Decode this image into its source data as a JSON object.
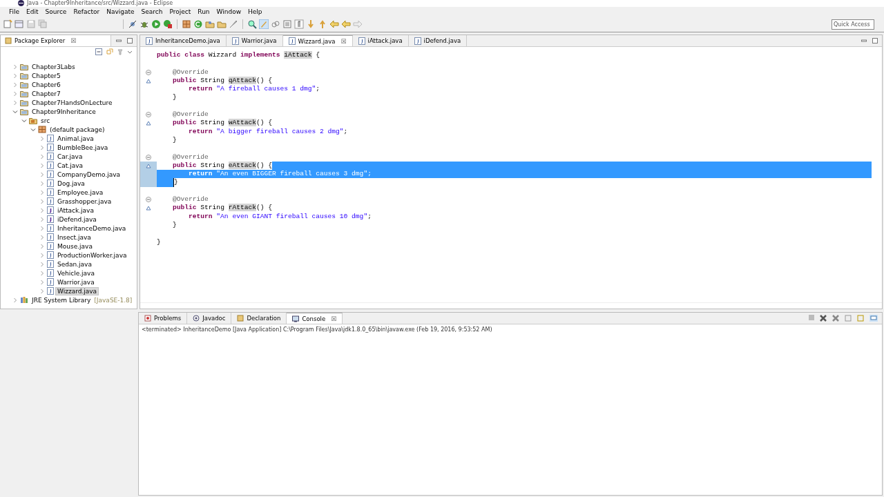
{
  "window": {
    "title": "Java - Chapter9Inheritance/src/Wizzard.java - Eclipse"
  },
  "menu": [
    "File",
    "Edit",
    "Source",
    "Refactor",
    "Navigate",
    "Search",
    "Project",
    "Run",
    "Window",
    "Help"
  ],
  "quick_access": {
    "placeholder": "Quick Access"
  },
  "package_explorer": {
    "title": "Package Explorer",
    "close": "☒",
    "tree": [
      {
        "label": "Chapter3Labs",
        "kind": "project",
        "expanded": false,
        "selected": false
      },
      {
        "label": "Chapter5",
        "kind": "project",
        "expanded": false,
        "selected": false
      },
      {
        "label": "Chapter6",
        "kind": "project",
        "expanded": false,
        "selected": false
      },
      {
        "label": "Chapter7",
        "kind": "project",
        "expanded": false,
        "selected": false
      },
      {
        "label": "Chapter7HandsOnLecture",
        "kind": "project",
        "expanded": false,
        "selected": false
      },
      {
        "label": "Chapter9Inheritance",
        "kind": "project",
        "expanded": true,
        "selected": false,
        "children": [
          {
            "label": "src",
            "kind": "source",
            "expanded": true,
            "selected": false,
            "children": [
              {
                "label": "(default package)",
                "kind": "package",
                "expanded": true,
                "selected": false,
                "children": [
                  {
                    "label": "Animal.java",
                    "kind": "java",
                    "expanded": false,
                    "selected": false
                  },
                  {
                    "label": "BumbleBee.java",
                    "kind": "java",
                    "expanded": false,
                    "selected": false
                  },
                  {
                    "label": "Car.java",
                    "kind": "java",
                    "expanded": false,
                    "selected": false
                  },
                  {
                    "label": "Cat.java",
                    "kind": "java",
                    "expanded": false,
                    "selected": false
                  },
                  {
                    "label": "CompanyDemo.java",
                    "kind": "java",
                    "expanded": false,
                    "selected": false
                  },
                  {
                    "label": "Dog.java",
                    "kind": "java",
                    "expanded": false,
                    "selected": false
                  },
                  {
                    "label": "Employee.java",
                    "kind": "java",
                    "expanded": false,
                    "selected": false
                  },
                  {
                    "label": "Grasshopper.java",
                    "kind": "java",
                    "expanded": false,
                    "selected": false
                  },
                  {
                    "label": "iAttack.java",
                    "kind": "interface",
                    "expanded": false,
                    "selected": false
                  },
                  {
                    "label": "iDefend.java",
                    "kind": "interface",
                    "expanded": false,
                    "selected": false
                  },
                  {
                    "label": "InheritanceDemo.java",
                    "kind": "java",
                    "expanded": false,
                    "selected": false
                  },
                  {
                    "label": "Insect.java",
                    "kind": "java",
                    "expanded": false,
                    "selected": false
                  },
                  {
                    "label": "Mouse.java",
                    "kind": "java",
                    "expanded": false,
                    "selected": false
                  },
                  {
                    "label": "ProductionWorker.java",
                    "kind": "java",
                    "expanded": false,
                    "selected": false
                  },
                  {
                    "label": "Sedan.java",
                    "kind": "java",
                    "expanded": false,
                    "selected": false
                  },
                  {
                    "label": "Vehicle.java",
                    "kind": "java",
                    "expanded": false,
                    "selected": false
                  },
                  {
                    "label": "Warrior.java",
                    "kind": "java",
                    "expanded": false,
                    "selected": false
                  },
                  {
                    "label": "Wizzard.java",
                    "kind": "java",
                    "expanded": false,
                    "selected": true
                  }
                ]
              }
            ]
          }
        ]
      },
      {
        "label": "JRE System Library",
        "decoration": "[JavaSE-1.8]",
        "kind": "library",
        "expanded": false,
        "selected": false
      }
    ]
  },
  "editor_tabs": [
    {
      "label": "InheritanceDemo.java",
      "selected": false
    },
    {
      "label": "Warrior.java",
      "selected": false
    },
    {
      "label": "Wizzard.java",
      "selected": true,
      "close": "☒"
    },
    {
      "label": "iAttack.java",
      "selected": false
    },
    {
      "label": "iDefend.java",
      "selected": false
    }
  ],
  "code": [
    {
      "kind": "class",
      "selected": false,
      "tokens": [
        {
          "t": "public class ",
          "kind": "keyword"
        },
        {
          "t": "Wizzard ",
          "kind": "plain"
        },
        {
          "t": "implements ",
          "kind": "keyword"
        },
        {
          "t": "iAttack",
          "kind": "occurrence"
        },
        {
          "t": " {",
          "kind": "plain"
        }
      ]
    },
    {
      "kind": "blank",
      "selected": false
    },
    {
      "kind": "annotation",
      "selected": false,
      "tokens": [
        {
          "t": "    @Override",
          "kind": "annotation"
        }
      ]
    },
    {
      "kind": "method",
      "selected": false,
      "tokens": [
        {
          "t": "    public ",
          "kind": "keyword"
        },
        {
          "t": "String ",
          "kind": "plain"
        },
        {
          "t": "qAttack",
          "kind": "occurrence"
        },
        {
          "t": "() {",
          "kind": "plain"
        }
      ]
    },
    {
      "kind": "statement",
      "selected": false,
      "tokens": [
        {
          "t": "        return ",
          "kind": "keyword"
        },
        {
          "t": "\"A fireball causes 1 dmg\"",
          "kind": "string"
        },
        {
          "t": ";",
          "kind": "plain"
        }
      ]
    },
    {
      "kind": "statement",
      "selected": false,
      "tokens": [
        {
          "t": "    }",
          "kind": "plain"
        }
      ]
    },
    {
      "kind": "blank",
      "selected": false
    },
    {
      "kind": "annotation",
      "selected": false,
      "tokens": [
        {
          "t": "    @Override",
          "kind": "annotation"
        }
      ]
    },
    {
      "kind": "method",
      "selected": false,
      "tokens": [
        {
          "t": "    public ",
          "kind": "keyword"
        },
        {
          "t": "String ",
          "kind": "plain"
        },
        {
          "t": "wAttack",
          "kind": "occurrence"
        },
        {
          "t": "() {",
          "kind": "plain"
        }
      ]
    },
    {
      "kind": "statement",
      "selected": false,
      "tokens": [
        {
          "t": "        return ",
          "kind": "keyword"
        },
        {
          "t": "\"A bigger fireball causes 2 dmg\"",
          "kind": "string"
        },
        {
          "t": ";",
          "kind": "plain"
        }
      ]
    },
    {
      "kind": "statement",
      "selected": false,
      "tokens": [
        {
          "t": "    }",
          "kind": "plain"
        }
      ]
    },
    {
      "kind": "blank",
      "selected": false
    },
    {
      "kind": "annotation",
      "selected": false,
      "tokens": [
        {
          "t": "    @Override",
          "kind": "annotation"
        }
      ]
    },
    {
      "kind": "method",
      "selected": true,
      "tokens": [
        {
          "t": "    public ",
          "kind": "keyword"
        },
        {
          "t": "String ",
          "kind": "plain"
        },
        {
          "t": "eAttack",
          "kind": "occurrence"
        },
        {
          "t": "() {",
          "kind": "plain"
        }
      ]
    },
    {
      "kind": "statement",
      "selected": true,
      "tokens": [
        {
          "t": "        return ",
          "kind": "keyword"
        },
        {
          "t": "\"An even BIGGER fireball causes 3 dmg\"",
          "kind": "string"
        },
        {
          "t": ";",
          "kind": "plain"
        }
      ]
    },
    {
      "kind": "statement",
      "selected": true,
      "tokens": [
        {
          "t": "    }",
          "kind": "plain"
        }
      ]
    },
    {
      "kind": "blank",
      "selected": false
    },
    {
      "kind": "annotation",
      "selected": false,
      "tokens": [
        {
          "t": "    @Override",
          "kind": "annotation"
        }
      ]
    },
    {
      "kind": "method",
      "selected": false,
      "tokens": [
        {
          "t": "    public ",
          "kind": "keyword"
        },
        {
          "t": "String ",
          "kind": "plain"
        },
        {
          "t": "rAttack",
          "kind": "occurrence"
        },
        {
          "t": "() {",
          "kind": "plain"
        }
      ]
    },
    {
      "kind": "statement",
      "selected": false,
      "tokens": [
        {
          "t": "        return ",
          "kind": "keyword"
        },
        {
          "t": "\"An even GIANT fireball causes 10 dmg\"",
          "kind": "string"
        },
        {
          "t": ";",
          "kind": "plain"
        }
      ]
    },
    {
      "kind": "statement",
      "selected": false,
      "tokens": [
        {
          "t": "    }",
          "kind": "plain"
        }
      ]
    },
    {
      "kind": "blank",
      "selected": false
    },
    {
      "kind": "class",
      "selected": false,
      "tokens": [
        {
          "t": "}",
          "kind": "plain"
        }
      ]
    }
  ],
  "bottom_tabs": [
    {
      "label": "Problems",
      "selected": false
    },
    {
      "label": "Javadoc",
      "selected": false
    },
    {
      "label": "Declaration",
      "selected": false
    },
    {
      "label": "Console",
      "selected": true,
      "close": "☒"
    }
  ],
  "console": {
    "header": "<terminated> InheritanceDemo [Java Application] C:\\Program Files\\Java\\jdk1.8.0_65\\bin\\javaw.exe (Feb 19, 2016, 9:53:52 AM)"
  }
}
